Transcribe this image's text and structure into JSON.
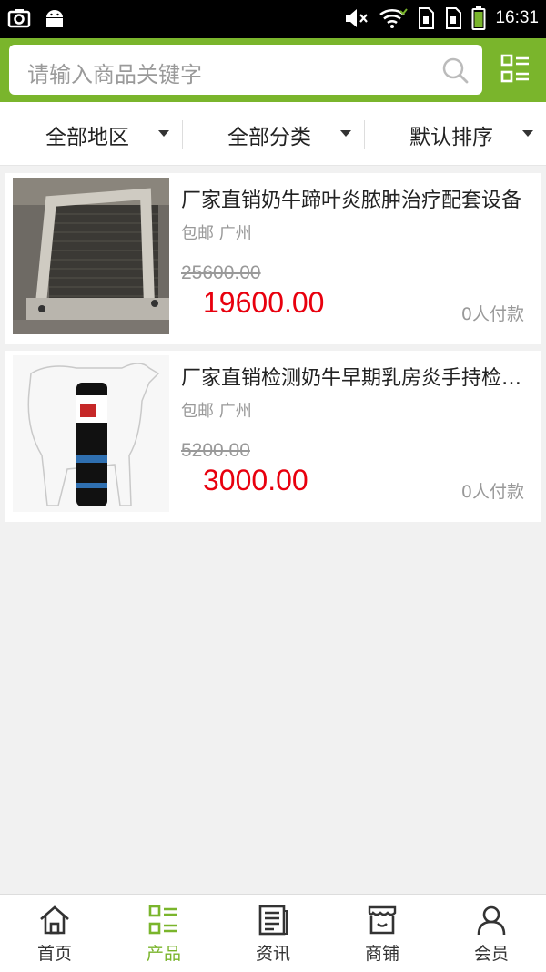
{
  "status_bar": {
    "time": "16:31",
    "icons": [
      "screenshot-icon",
      "android-icon",
      "mute-icon",
      "wifi-icon",
      "sim1-icon",
      "sim2-icon",
      "battery-icon"
    ]
  },
  "header": {
    "search_placeholder": "请输入商品关键字",
    "search_icon": "search-icon",
    "menu_icon": "grid-list-icon"
  },
  "filters": [
    {
      "label": "全部地区"
    },
    {
      "label": "全部分类"
    },
    {
      "label": "默认排序"
    }
  ],
  "products": [
    {
      "title": "厂家直销奶牛蹄叶炎脓肿治疗配套设备",
      "shipping": "包邮 广州",
      "old_price": "25600.00",
      "price": "19600.00",
      "paid": "0人付款"
    },
    {
      "title": "厂家直销检测奶牛早期乳房炎手持检测仪",
      "shipping": "包邮 广州",
      "old_price": "5200.00",
      "price": "3000.00",
      "paid": "0人付款"
    }
  ],
  "bottom_nav": [
    {
      "label": "首页",
      "icon": "home-icon",
      "active": false
    },
    {
      "label": "产品",
      "icon": "product-list-icon",
      "active": true
    },
    {
      "label": "资讯",
      "icon": "news-icon",
      "active": false
    },
    {
      "label": "商铺",
      "icon": "shop-icon",
      "active": false
    },
    {
      "label": "会员",
      "icon": "user-icon",
      "active": false
    }
  ],
  "colors": {
    "accent": "#7ab52c",
    "price": "#e8000e",
    "muted": "#999999"
  }
}
